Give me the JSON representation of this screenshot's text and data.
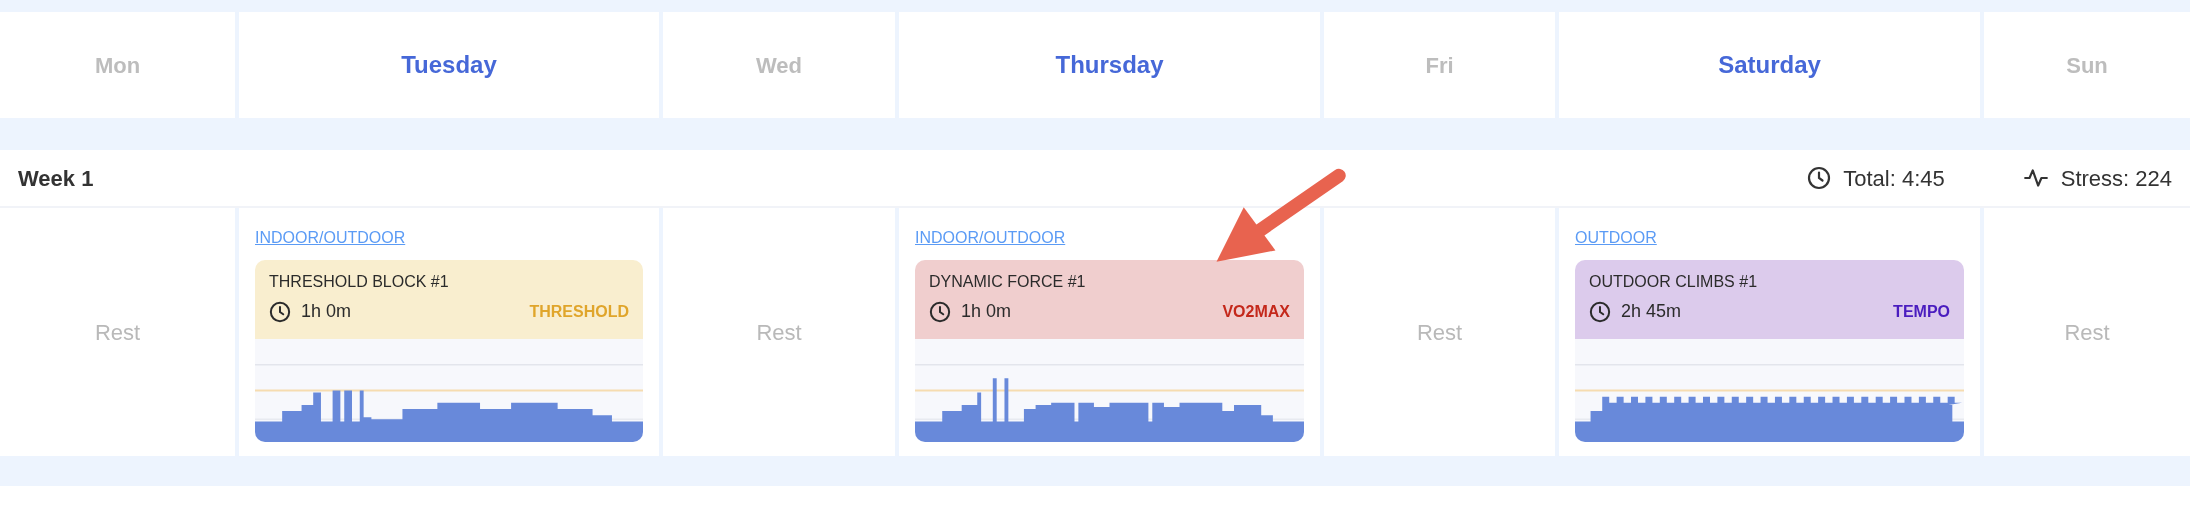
{
  "days": [
    {
      "label": "Mon",
      "active": false
    },
    {
      "label": "Tuesday",
      "active": true
    },
    {
      "label": "Wed",
      "active": false
    },
    {
      "label": "Thursday",
      "active": true
    },
    {
      "label": "Fri",
      "active": false
    },
    {
      "label": "Saturday",
      "active": true
    },
    {
      "label": "Sun",
      "active": false
    }
  ],
  "week": {
    "title": "Week 1",
    "total": "Total: 4:45",
    "stress": "Stress: 224",
    "cells": [
      {
        "kind": "rest",
        "label": "Rest"
      },
      {
        "kind": "workout",
        "link": "INDOOR/OUTDOOR",
        "title": "THRESHOLD BLOCK #1",
        "duration": "1h 0m",
        "zone": {
          "kind": "threshold",
          "label": "THRESHOLD"
        }
      },
      {
        "kind": "rest",
        "label": "Rest"
      },
      {
        "kind": "workout",
        "link": "INDOOR/OUTDOOR",
        "title": "DYNAMIC FORCE #1",
        "duration": "1h 0m",
        "zone": {
          "kind": "vo2max",
          "label": "VO2MAX"
        }
      },
      {
        "kind": "rest",
        "label": "Rest"
      },
      {
        "kind": "workout",
        "link": "OUTDOOR",
        "title": "OUTDOOR CLIMBS #1",
        "duration": "2h 45m",
        "zone": {
          "kind": "tempo",
          "label": "TEMPO"
        }
      },
      {
        "kind": "rest",
        "label": "Rest"
      }
    ]
  }
}
